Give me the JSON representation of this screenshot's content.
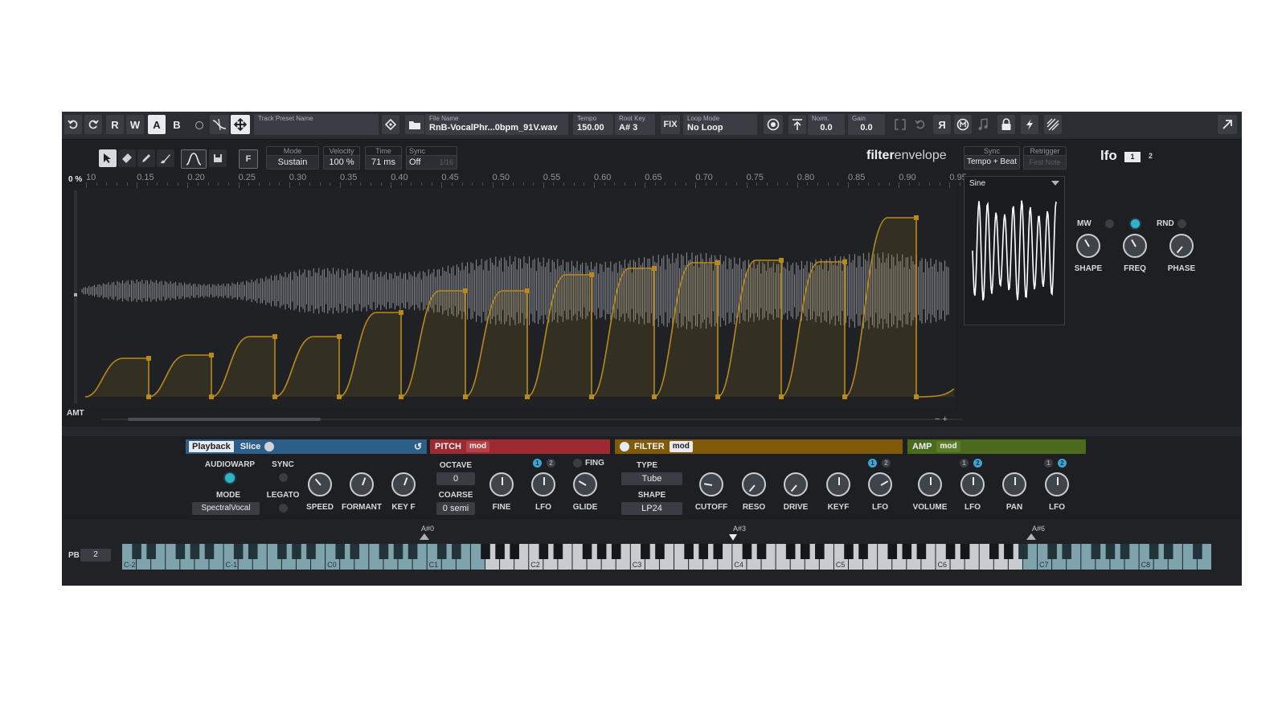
{
  "toolbar": {
    "undo_icon": "undo-icon",
    "redo_icon": "redo-icon",
    "read_label": "R",
    "write_label": "W",
    "a_label": "A",
    "b_label": "B",
    "preset": {
      "label": "Track Preset Name",
      "value": ""
    },
    "file": {
      "label": "File Name",
      "value": "RnB-VocalPhr...0bpm_91V.wav"
    },
    "tempo": {
      "label": "Tempo",
      "value": "150.00"
    },
    "root_key": {
      "label": "Root Key",
      "value": "A# 3"
    },
    "fix_label": "FIX",
    "loop_mode": {
      "label": "Loop Mode",
      "value": "No Loop"
    },
    "norm": {
      "label": "Norm.",
      "value": "0.0"
    },
    "gain": {
      "label": "Gain",
      "value": "0.0"
    },
    "reverse_label": "Я"
  },
  "editor": {
    "mode": {
      "label": "Mode",
      "value": "Sustain"
    },
    "velocity": {
      "label": "Velocity",
      "value": "100 %"
    },
    "time": {
      "label": "Time",
      "value": "71 ms"
    },
    "sync": {
      "label": "Sync",
      "value": "Off",
      "grid": "1/16"
    },
    "f_label": "F",
    "title_bold": "filter",
    "title_light": "envelope",
    "percent_label": "0 %",
    "amt_label": "AMT",
    "zoom_label": "− +",
    "ruler": [
      "10",
      "0.15",
      "0.20",
      "0.25",
      "0.30",
      "0.35",
      "0.40",
      "0.45",
      "0.50",
      "0.55",
      "0.60",
      "0.65",
      "0.70",
      "0.75",
      "0.80",
      "0.85",
      "0.90",
      "0.95"
    ]
  },
  "lfo": {
    "sync": {
      "label": "Sync",
      "value": "Tempo + Beat"
    },
    "retrigger": {
      "label": "Retrigger",
      "value": "First Note"
    },
    "title": "lfo",
    "tab1": "1",
    "tab2": "2",
    "waveform": "Sine",
    "mw_label": "MW",
    "rnd_label": "RND",
    "knobs": [
      "SHAPE",
      "FREQ",
      "PHASE"
    ]
  },
  "playback": {
    "tab_playback": "Playback",
    "tab_slice": "Slice",
    "audiowarp_label": "AUDIOWARP",
    "sync_label": "SYNC",
    "mode_label": "MODE",
    "mode_value": "SpectralVocal",
    "legato_label": "LEGATO",
    "knobs": [
      "SPEED",
      "FORMANT",
      "KEY F"
    ]
  },
  "pitch": {
    "title": "PITCH",
    "mod": "mod",
    "octave_label": "OCTAVE",
    "octave_value": "0",
    "coarse_label": "COARSE",
    "coarse_value": "0 semi",
    "fing_label": "FING",
    "knobs": [
      "FINE",
      "LFO",
      "GLIDE"
    ],
    "lfo1": "1",
    "lfo2": "2"
  },
  "filter": {
    "title": "FILTER",
    "mod": "mod",
    "type_label": "TYPE",
    "type_value": "Tube",
    "shape_label": "SHAPE",
    "shape_value": "LP24",
    "knobs": [
      "CUTOFF",
      "RESO",
      "DRIVE",
      "KEYF",
      "LFO"
    ],
    "lfo1": "1",
    "lfo2": "2"
  },
  "amp": {
    "title": "AMP",
    "mod": "mod",
    "knobs": [
      "VOLUME",
      "LFO",
      "PAN",
      "LFO"
    ],
    "lfo_a1": "1",
    "lfo_a2": "2",
    "lfo_b1": "1",
    "lfo_b2": "2"
  },
  "keyboard": {
    "pb_label": "PB",
    "pb_value": "2",
    "range_low": "A#0",
    "root": "A#3",
    "range_high": "A#6",
    "octaves": [
      "C-2",
      "C-1",
      "C0",
      "C1",
      "C2",
      "C3",
      "C4",
      "C5",
      "C6",
      "C7",
      "C8"
    ]
  },
  "colors": {
    "playback": "#2b5f8a",
    "pitch": "#9e2a31",
    "filter": "#7f5a08",
    "amp": "#4c6a1c",
    "envelope": "#b88a1b",
    "accent": "#2fb1c9"
  }
}
